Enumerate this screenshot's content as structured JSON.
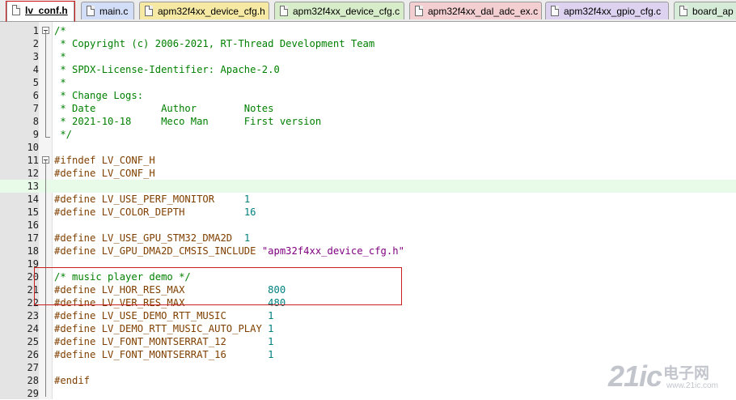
{
  "tabs": [
    {
      "label": "lv_conf.h",
      "color": "#ffffff",
      "active": true
    },
    {
      "label": "main.c",
      "color": "#d2ddf7",
      "active": false
    },
    {
      "label": "apm32f4xx_device_cfg.h",
      "color": "#f6e9a4",
      "active": false
    },
    {
      "label": "apm32f4xx_device_cfg.c",
      "color": "#d7ecc8",
      "active": false
    },
    {
      "label": "apm32f4xx_dal_adc_ex.c",
      "color": "#f4cfd1",
      "active": false
    },
    {
      "label": "apm32f4xx_gpio_cfg.c",
      "color": "#ddd3f0",
      "active": false
    },
    {
      "label": "board_ap",
      "color": "#d6ecd8",
      "active": false
    }
  ],
  "editor": {
    "current_line": 13,
    "lines": [
      {
        "n": "1",
        "t": [
          [
            "cm",
            "/*"
          ]
        ]
      },
      {
        "n": "2",
        "t": [
          [
            "cm",
            " * Copyright (c) 2006-2021, RT-Thread Development Team"
          ]
        ]
      },
      {
        "n": "3",
        "t": [
          [
            "cm",
            " *"
          ]
        ]
      },
      {
        "n": "4",
        "t": [
          [
            "cm",
            " * SPDX-License-Identifier: Apache-2.0"
          ]
        ]
      },
      {
        "n": "5",
        "t": [
          [
            "cm",
            " *"
          ]
        ]
      },
      {
        "n": "6",
        "t": [
          [
            "cm",
            " * Change Logs:"
          ]
        ]
      },
      {
        "n": "7",
        "t": [
          [
            "cm",
            " * Date           Author        Notes"
          ]
        ]
      },
      {
        "n": "8",
        "t": [
          [
            "cm",
            " * 2021-10-18     Meco Man      First version"
          ]
        ]
      },
      {
        "n": "9",
        "t": [
          [
            "cm",
            " */"
          ]
        ]
      },
      {
        "n": "10",
        "t": []
      },
      {
        "n": "11",
        "t": [
          [
            "pp",
            "#ifndef LV_CONF_H"
          ]
        ]
      },
      {
        "n": "12",
        "t": [
          [
            "pp",
            "#define LV_CONF_H"
          ]
        ]
      },
      {
        "n": "13",
        "t": []
      },
      {
        "n": "14",
        "t": [
          [
            "pp",
            "#define LV_USE_PERF_MONITOR     "
          ],
          [
            "num",
            "1"
          ]
        ]
      },
      {
        "n": "15",
        "t": [
          [
            "pp",
            "#define LV_COLOR_DEPTH          "
          ],
          [
            "num",
            "16"
          ]
        ]
      },
      {
        "n": "16",
        "t": []
      },
      {
        "n": "17",
        "t": [
          [
            "pp",
            "#define LV_USE_GPU_STM32_DMA2D  "
          ],
          [
            "num",
            "1"
          ]
        ]
      },
      {
        "n": "18",
        "t": [
          [
            "pp",
            "#define LV_GPU_DMA2D_CMSIS_INCLUDE "
          ],
          [
            "str",
            "\"apm32f4xx_device_cfg.h\""
          ]
        ]
      },
      {
        "n": "19",
        "t": []
      },
      {
        "n": "20",
        "t": [
          [
            "cm",
            "/* music player demo */"
          ]
        ]
      },
      {
        "n": "21",
        "t": [
          [
            "pp",
            "#define LV_HOR_RES_MAX              "
          ],
          [
            "num",
            "800"
          ]
        ]
      },
      {
        "n": "22",
        "t": [
          [
            "pp",
            "#define LV_VER_RES_MAX              "
          ],
          [
            "num",
            "480"
          ]
        ]
      },
      {
        "n": "23",
        "t": [
          [
            "pp",
            "#define LV_USE_DEMO_RTT_MUSIC       "
          ],
          [
            "num",
            "1"
          ]
        ]
      },
      {
        "n": "24",
        "t": [
          [
            "pp",
            "#define LV_DEMO_RTT_MUSIC_AUTO_PLAY "
          ],
          [
            "num",
            "1"
          ]
        ]
      },
      {
        "n": "25",
        "t": [
          [
            "pp",
            "#define LV_FONT_MONTSERRAT_12       "
          ],
          [
            "num",
            "1"
          ]
        ]
      },
      {
        "n": "26",
        "t": [
          [
            "pp",
            "#define LV_FONT_MONTSERRAT_16       "
          ],
          [
            "num",
            "1"
          ]
        ]
      },
      {
        "n": "27",
        "t": []
      },
      {
        "n": "28",
        "t": [
          [
            "pp",
            "#endif"
          ]
        ]
      },
      {
        "n": "29",
        "t": []
      }
    ]
  },
  "watermark": {
    "main": "21ic",
    "cn": "电子网",
    "url": "www.21ic.com"
  }
}
